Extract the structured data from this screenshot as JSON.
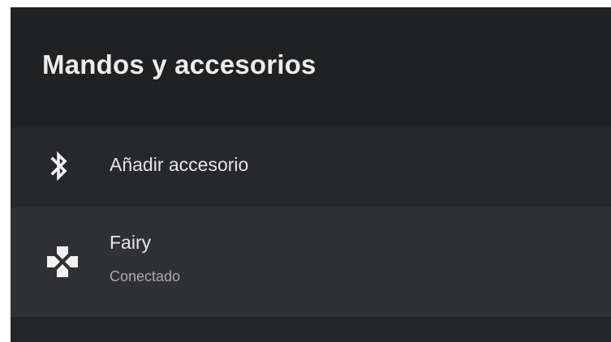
{
  "header": {
    "title": "Mandos y accesorios"
  },
  "menu": {
    "add_accessory": {
      "label": "Añadir accesorio",
      "icon": "bluetooth-icon"
    },
    "devices": [
      {
        "name": "Fairy",
        "status": "Conectado",
        "icon": "gamepad-icon"
      }
    ]
  },
  "colors": {
    "background": "#212224",
    "row_add": "#27282b",
    "row_selected": "#303134",
    "text_primary": "#e6e6e6",
    "text_secondary": "#a9a9ab"
  }
}
